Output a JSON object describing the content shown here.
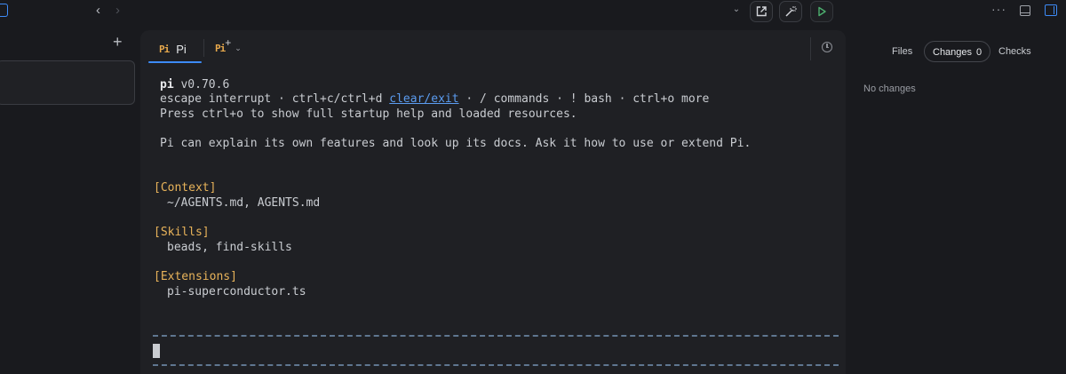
{
  "topbar": {
    "nav_back": "‹",
    "nav_forward": "›",
    "chevron": "⌄",
    "more": "···"
  },
  "tabs": {
    "active": {
      "logo": "Pi",
      "label": "Pi"
    },
    "new_tab_logo": "Pi",
    "new_tab_plus": "+",
    "new_tab_chevron": "⌄"
  },
  "terminal": {
    "app_name": "pi",
    "version": "v0.70.6",
    "hint_prefix": "escape interrupt · ctrl+c/ctrl+d ",
    "hint_link": "clear/exit",
    "hint_suffix": " · / commands · ! bash · ctrl+o more",
    "startup_help": "Press ctrl+o to show full startup help and loaded resources.",
    "features_line": "Pi can explain its own features and look up its docs. Ask it how to use or extend Pi.",
    "sections": [
      {
        "title": "[Context]",
        "content": "~/AGENTS.md, AGENTS.md"
      },
      {
        "title": "[Skills]",
        "content": "beads, find-skills"
      },
      {
        "title": "[Extensions]",
        "content": "pi-superconductor.ts"
      }
    ]
  },
  "right_panel": {
    "tabs": [
      {
        "label": "Files"
      },
      {
        "label": "Changes",
        "count": "0"
      },
      {
        "label": "Checks"
      }
    ],
    "empty_message": "No changes"
  },
  "colors": {
    "accent": "#3d8bf7",
    "section": "#e8b35a",
    "link": "#5b9cf0"
  }
}
